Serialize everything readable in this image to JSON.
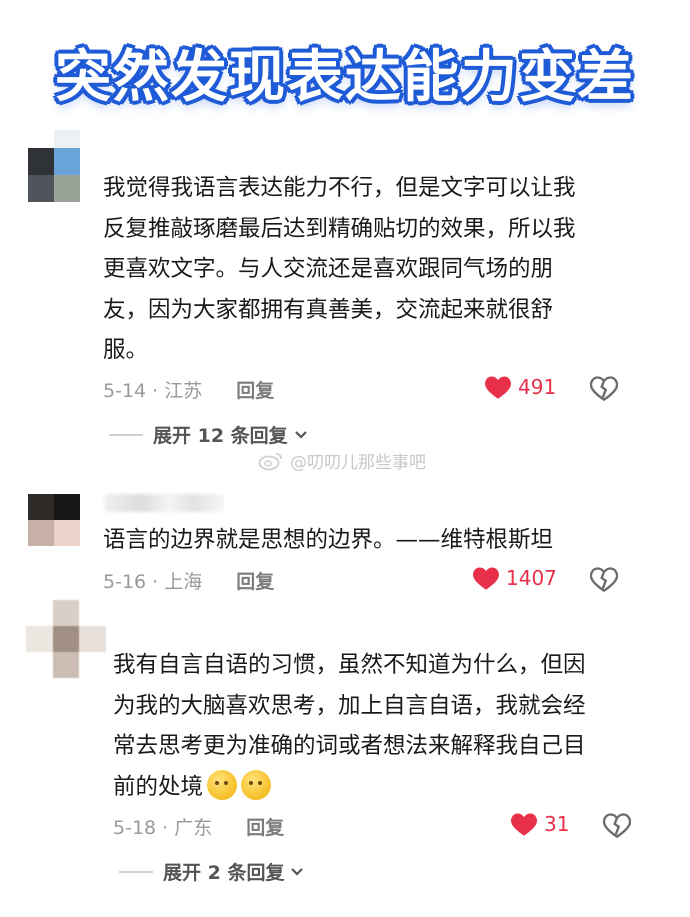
{
  "header": {
    "title": "突然发现表达能力变差"
  },
  "watermark": {
    "text": "@叨叨儿那些事吧"
  },
  "comments": [
    {
      "lines": [
        "我觉得我语言表达能力不行，但是文字可以让我",
        "反复推敲琢磨最后达到精确贴切的效果，所以我",
        "更喜欢文字。与人交流还是喜欢跟同气场的朋",
        "友，因为大家都拥有真善美，交流起来就很舒",
        "服。"
      ],
      "meta": "5-14 · 江苏",
      "reply_label": "回复",
      "likes": "491",
      "expand_label": "展开 12 条回复"
    },
    {
      "lines": [
        "语言的边界就是思想的边界。——维特根斯坦"
      ],
      "meta": "5-16 · 上海",
      "reply_label": "回复",
      "likes": "1407"
    },
    {
      "lines": [
        "我有自言自语的习惯，虽然不知道为什么，但因",
        "为我的大脑喜欢思考，加上自言自语，我就会经",
        "常去思考更为准确的词或者想法来解释我自己目",
        "前的处境"
      ],
      "emojis": [
        "thinking-emoji",
        "thinking-emoji"
      ],
      "meta": "5-18 · 广东",
      "reply_label": "回复",
      "likes": "31",
      "expand_label": "展开 2 条回复"
    }
  ],
  "colors": {
    "title_outline": "#1f5bd6",
    "like": "#e8304b",
    "meta": "#9a9a9a"
  },
  "icons": {
    "like": "heart-icon",
    "dislike": "broken-heart-icon",
    "expand": "chevron-down-icon",
    "watermark": "weibo-icon"
  }
}
